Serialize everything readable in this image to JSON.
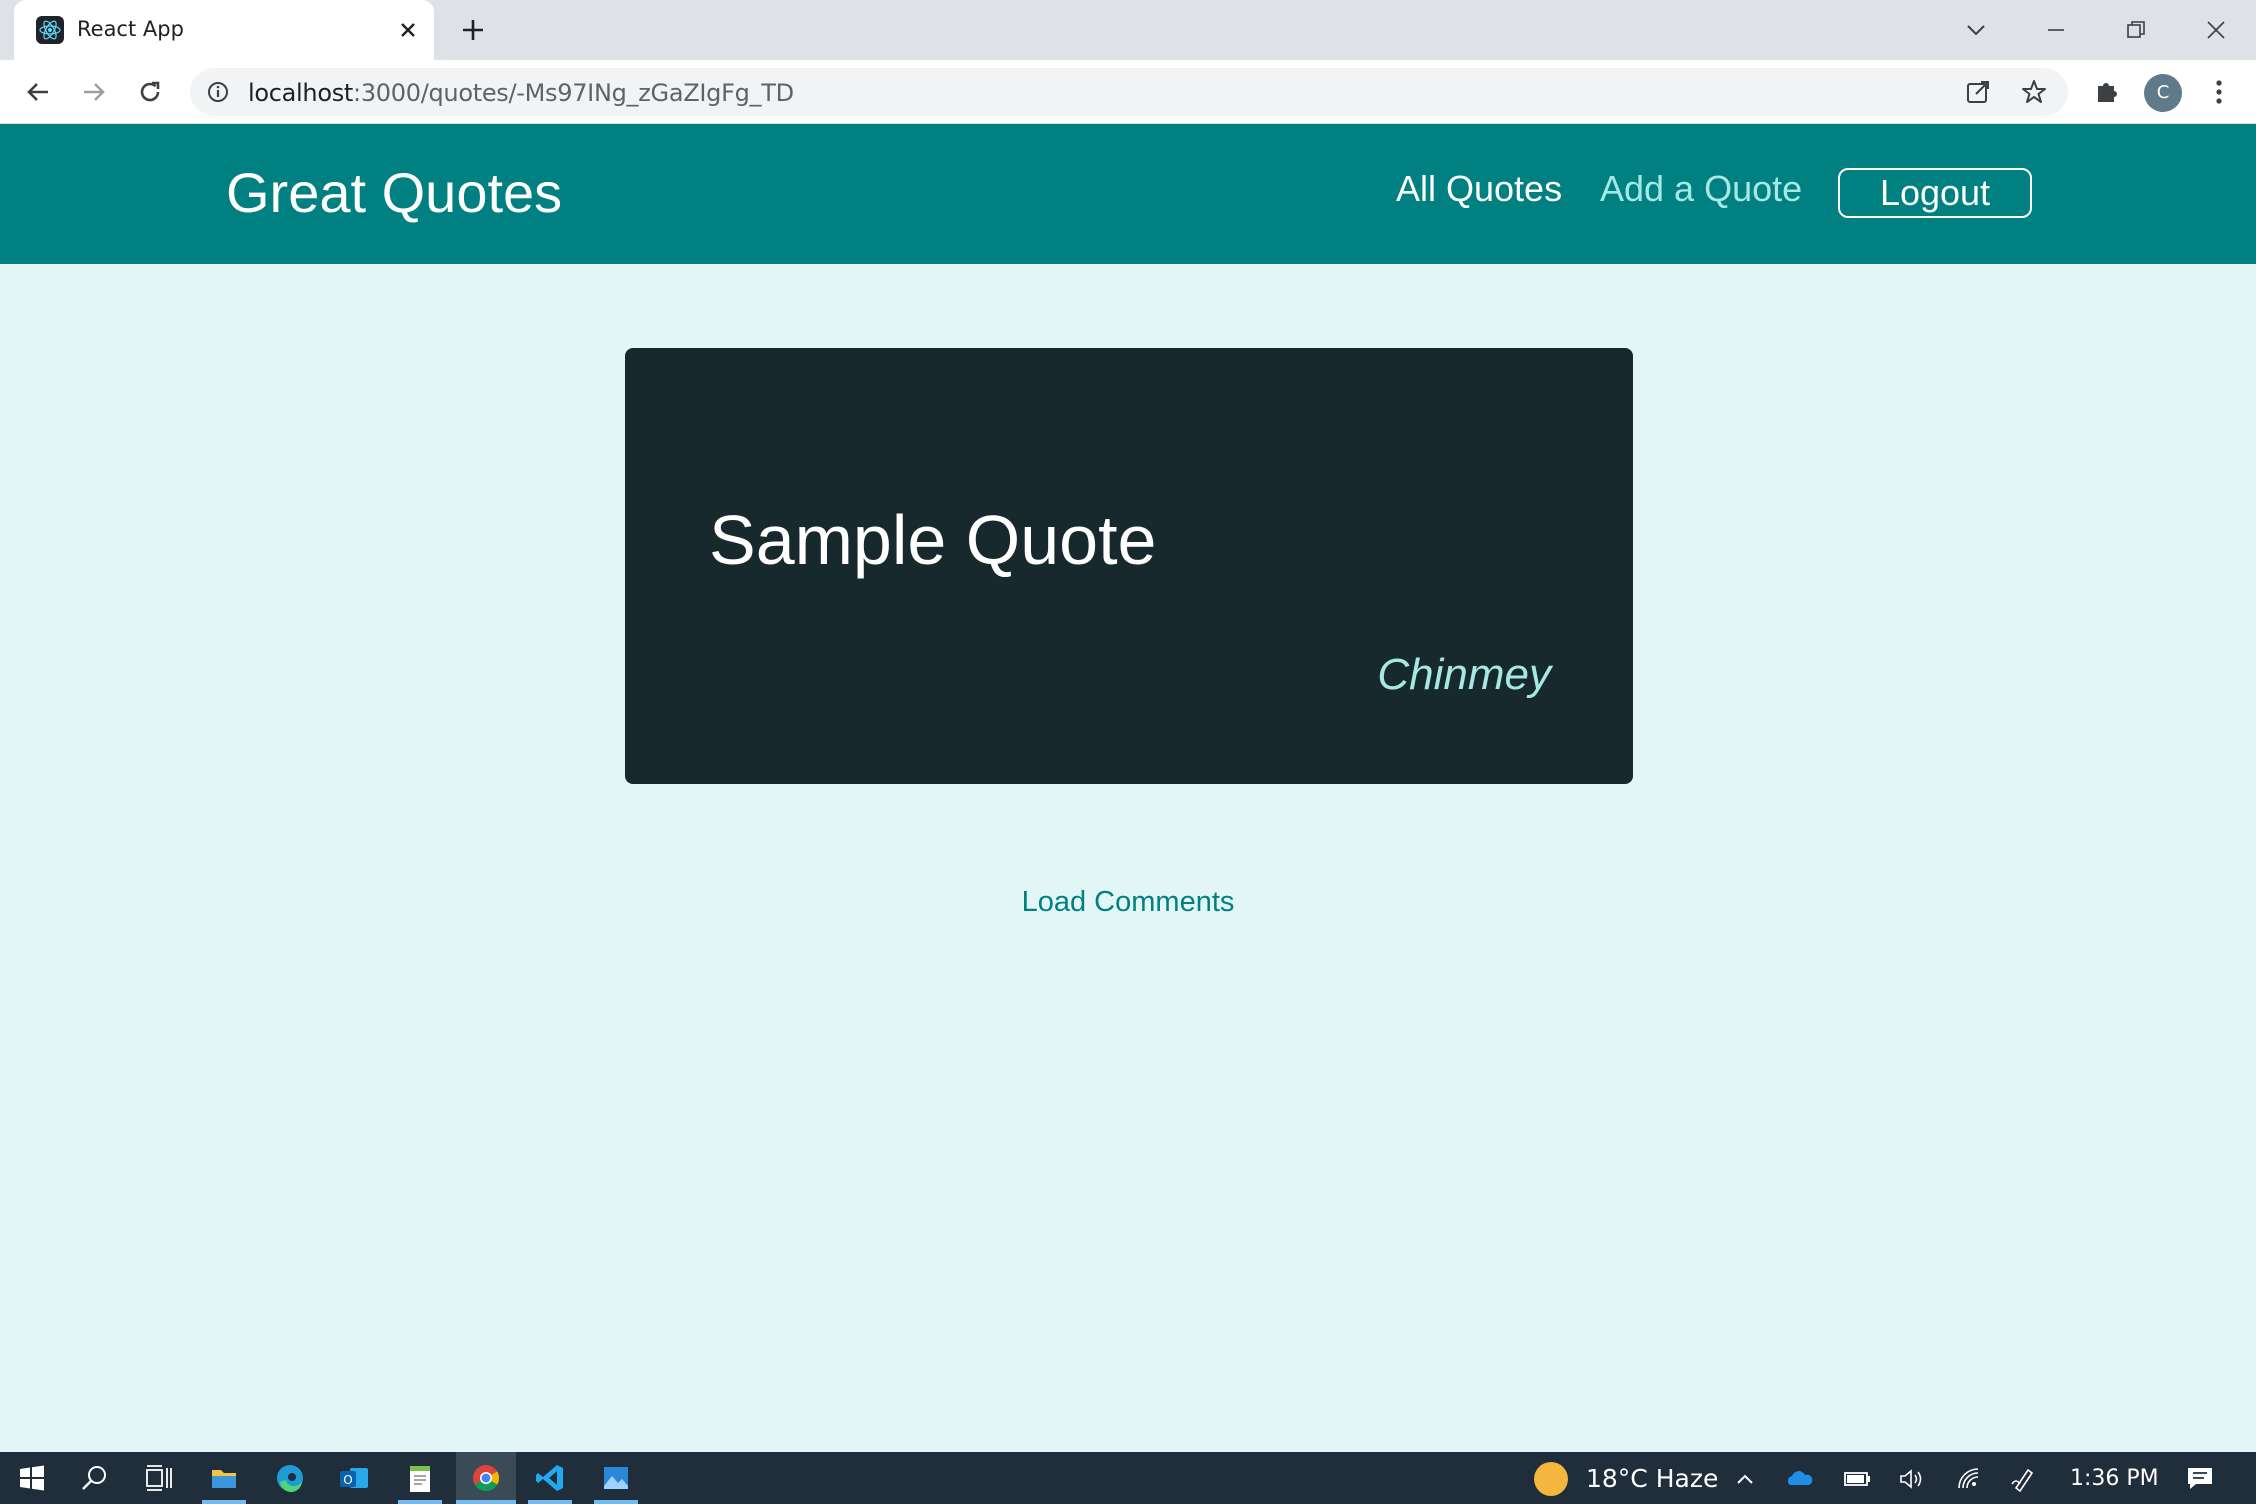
{
  "browser": {
    "tab_title": "React App",
    "url_host": "localhost",
    "url_path": ":3000/quotes/-Ms97INg_zGaZIgFg_TD",
    "profile_initial": "C"
  },
  "header": {
    "logo": "Great Quotes",
    "nav": [
      {
        "label": "All Quotes"
      },
      {
        "label": "Add a Quote"
      }
    ],
    "logout_label": "Logout"
  },
  "quote": {
    "text": "Sample Quote",
    "author": "Chinmey"
  },
  "load_comments_label": "Load Comments",
  "taskbar": {
    "weather": "18°C  Haze",
    "clock": "1:36 PM"
  },
  "colors": {
    "header_bg": "#008080",
    "page_bg": "#e2f6f6",
    "card_bg": "#18292d",
    "accent_light": "#a5e8e4"
  }
}
